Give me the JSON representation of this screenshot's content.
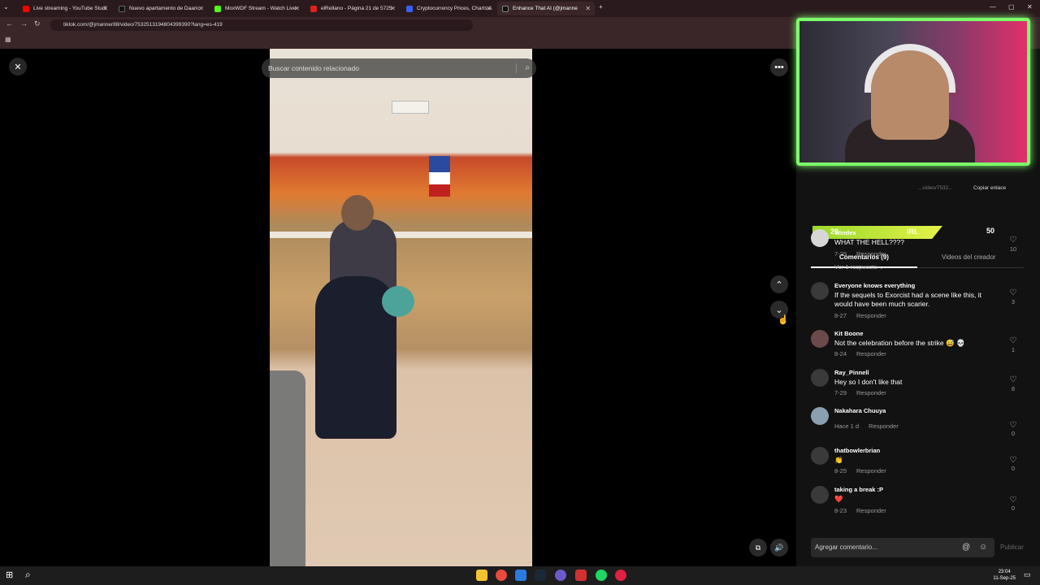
{
  "browser": {
    "tabs": [
      {
        "label": "Live streaming - YouTube Studi",
        "color": "#ff0000"
      },
      {
        "label": "Nuevo apartamento de Daaric",
        "color": "#111111"
      },
      {
        "label": "MoxWDF Stream - Watch Live",
        "color": "#53fc18"
      },
      {
        "label": "elRellano - Página 21 de 5725",
        "color": "#e02020"
      },
      {
        "label": "Cryptocurrency Prices, Charts A",
        "color": "#3861fb"
      },
      {
        "label": "Enhance That AI (@jmanne",
        "color": "#111111"
      }
    ],
    "url": "tiktok.com/@jmanner88/video/7532513194804399390?lang=es-419"
  },
  "video": {
    "search_placeholder": "Buscar contenido relacionado",
    "icons": [
      "close-icon",
      "more-icon",
      "chevron-up-icon",
      "chevron-down-icon",
      "volume-icon",
      "pip-icon"
    ]
  },
  "overlay_stats": {
    "left": "28",
    "mid": "IRL",
    "right": "50"
  },
  "panel": {
    "faint_link": "...video/7532...",
    "copy_link": "Copiar enlace",
    "tabs": [
      {
        "label": "Comentarios (9)"
      },
      {
        "label": "Videos del creador"
      }
    ],
    "comments": [
      {
        "user": "Windex",
        "text": "WHAT THE HELL????",
        "date": "7-29",
        "reply": "Responder",
        "likes": "10",
        "replies": "Ver 1 respuesta ⌄"
      },
      {
        "user": "Everyone knows everything",
        "text": "If the sequels to Exorcist had a scene like this, it would have been much scarier.",
        "date": "8-27",
        "reply": "Responder",
        "likes": "3"
      },
      {
        "user": "Kit Boone",
        "text": "Not the celebration before the strike 😅 💀",
        "date": "8-24",
        "reply": "Responder",
        "likes": "1"
      },
      {
        "user": "Ray_Pinnell",
        "text": "Hey so I don't like that",
        "date": "7-29",
        "reply": "Responder",
        "likes": "8"
      },
      {
        "user": "Nakahara Chuuya",
        "text": "",
        "date": "Hace 1 d",
        "reply": "Responder",
        "likes": "0"
      },
      {
        "user": "thatbowlerbrian",
        "text": "👏",
        "date": "8-25",
        "reply": "Responder",
        "likes": "0"
      },
      {
        "user": "taking a break :P",
        "text": "❤️",
        "date": "8-23",
        "reply": "Responder",
        "likes": "0"
      }
    ],
    "input_placeholder": "Agregar comentario...",
    "publish_label": "Publicar"
  },
  "taskbar": {
    "time": "23:04",
    "date": "11-Sep-25"
  }
}
